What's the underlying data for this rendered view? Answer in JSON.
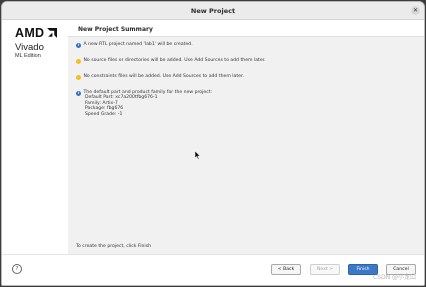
{
  "window": {
    "title": "New Project",
    "close_glyph": "✕"
  },
  "branding": {
    "amd": "AMD",
    "vivado": "Vivado",
    "edition": "ML Edition"
  },
  "page": {
    "title": "New Project Summary",
    "messages": [
      {
        "type": "info",
        "icon": "info-icon",
        "text": "A new RTL project named 'lab1' will be created."
      },
      {
        "type": "warning",
        "icon": "warning-icon",
        "text": "No source files or directories will be added. Use Add Sources to add them later."
      },
      {
        "type": "warning",
        "icon": "warning-icon",
        "text": "No constraints files will be added. Use Add Sources to add them later."
      },
      {
        "type": "info",
        "icon": "info-icon",
        "text": "The default part and product family for the new project:\n Default Part: xc7a200tfbg676-1\n Family: Artix-7\n Package: fbg676\n Speed Grade: -1"
      }
    ],
    "footer_note": "To create the project, click Finish"
  },
  "buttons": {
    "help": "?",
    "back": "< Back",
    "next": "Next >",
    "finish": "Finish",
    "cancel": "Cancel"
  },
  "watermark": "CSDN @小龙山",
  "colors": {
    "accent": "#3c78c8",
    "info": "#3d6fb6",
    "warning": "#f0c020"
  }
}
